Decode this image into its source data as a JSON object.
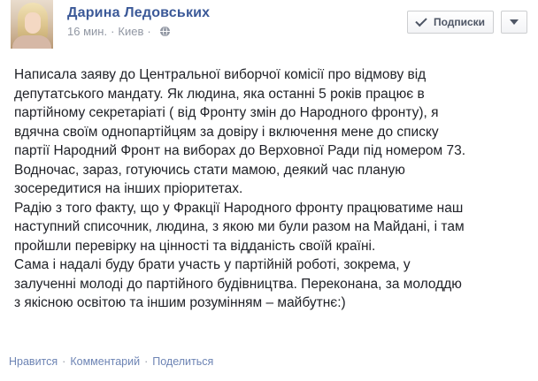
{
  "post": {
    "author": "Дарина Ледовських",
    "time": "16 мин.",
    "separator": "·",
    "location": "Киев",
    "location_separator": "·",
    "follow_label": "Подписки",
    "body": "Написала заяву до Центральної виборчої комісії про відмову від\nдепутатського мандату. Як людина, яка останні 5 років працює в\nпартійному секретаріаті ( від Фронту змін до Народного фронту), я\nвдячна своїм однопартійцям за довіру і включення мене до списку\nпартії Народний Фронт на виборах до Верховної Ради під номером 73.\nВодночас, зараз, готуючись стати мамою, деякий час планую\nзосередитися на інших пріоритетах.\nРадію з того факту, що у Фракції Народного фронту працюватиме наш\nнаступний списочник, людина, з якою ми були разом на Майдані, і там\nпройшли перевірку на цінності та відданість своїй країні.\nСама і надалі буду брати участь у партійній роботі, зокрема, у\nзалученні молоді до партійного будівництва. Переконана, за молоддю\nз якісною освітою та іншим розумінням – майбутнє:)",
    "actions": {
      "like": "Нравится",
      "comment": "Комментарий",
      "share": "Поделиться",
      "separator": "·"
    }
  },
  "icons": {
    "follow": "check-icon",
    "options": "chevron-down-icon",
    "privacy": "globe-icon"
  },
  "colors": {
    "author_link": "#3b5998",
    "meta_text": "#9197a3",
    "action_link": "#6d84b4"
  }
}
